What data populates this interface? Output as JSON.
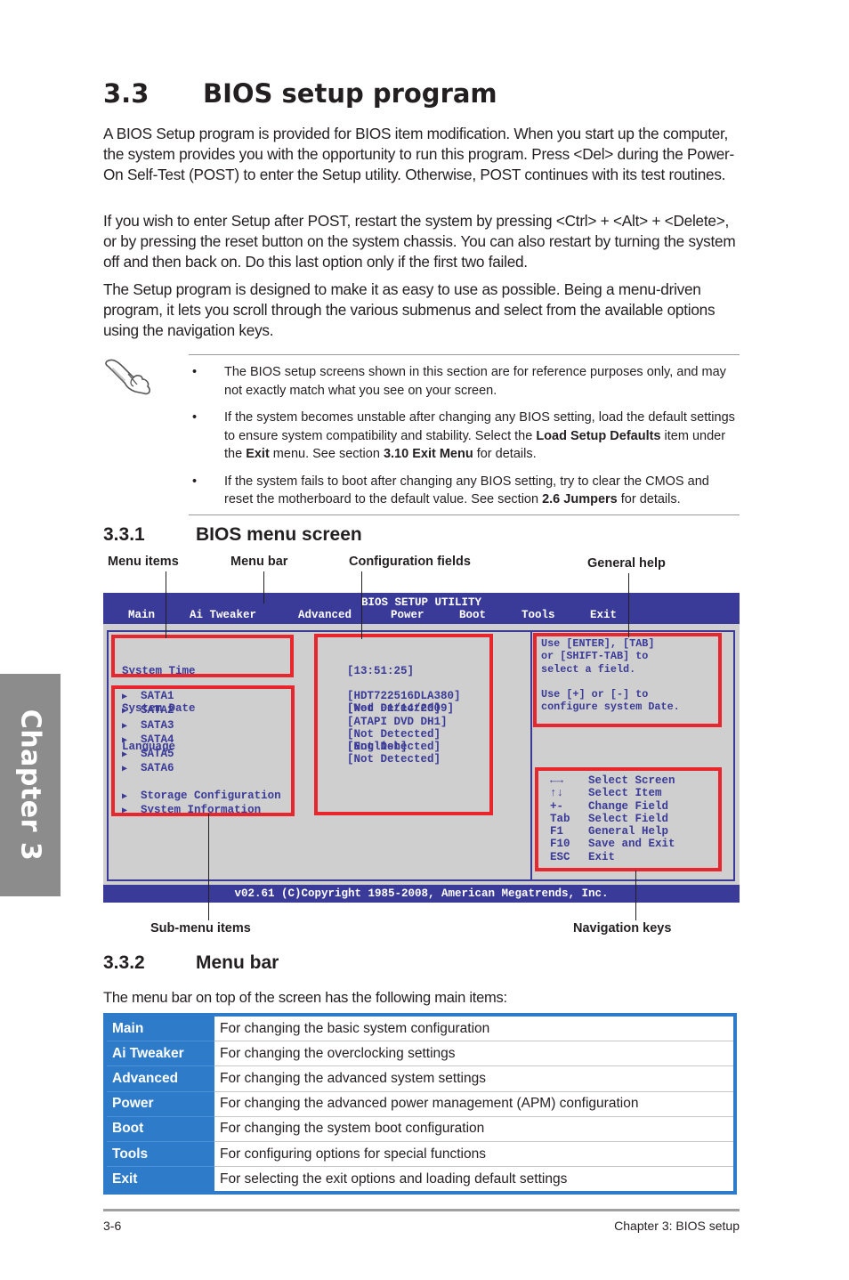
{
  "chapter_tab": "Chapter 3",
  "section": {
    "number": "3.3",
    "title": "BIOS setup program",
    "paragraphs": [
      "A BIOS Setup program is provided for BIOS item modification. When you start up the computer, the system provides you with the opportunity to run this program. Press <Del> during the Power-On Self-Test (POST) to enter the Setup utility. Otherwise, POST continues with its test routines.",
      "If you wish to enter Setup after POST, restart the system by pressing <Ctrl> + <Alt> + <Delete>, or by pressing the reset button on the system chassis. You can also restart by turning the system off and then back on. Do this last option only if the first two failed.",
      "The Setup program is designed to make it as easy to use as possible. Being a menu-driven program, it lets you scroll through the various submenus and select from the available options using the navigation keys."
    ]
  },
  "note": {
    "icon": "hand-pointer-icon",
    "bullet": "•",
    "items": [
      {
        "parts": [
          {
            "t": "The BIOS setup screens shown in this section are for reference purposes only, and may not exactly match what you see on your screen.",
            "b": false
          }
        ]
      },
      {
        "parts": [
          {
            "t": "If the system becomes unstable after changing any BIOS setting, load the default settings to ensure system compatibility and stability. Select the ",
            "b": false
          },
          {
            "t": "Load Setup Defaults",
            "b": true
          },
          {
            "t": " item under the ",
            "b": false
          },
          {
            "t": "Exit",
            "b": true
          },
          {
            "t": " menu. See section ",
            "b": false
          },
          {
            "t": "3.10 Exit Menu",
            "b": true
          },
          {
            "t": " for details.",
            "b": false
          }
        ]
      },
      {
        "parts": [
          {
            "t": "If the system fails to boot after changing any BIOS setting, try to clear the CMOS and reset the motherboard to the default value. See section ",
            "b": false
          },
          {
            "t": "2.6 Jumpers",
            "b": true
          },
          {
            "t": " for details.",
            "b": false
          }
        ]
      }
    ]
  },
  "subsection1": {
    "number": "3.3.1",
    "title": "BIOS menu screen"
  },
  "callouts": {
    "menu_items": "Menu items",
    "menu_bar": "Menu bar",
    "config_fields": "Configuration fields",
    "general_help": "General help",
    "sub_menu_items": "Sub-menu items",
    "navigation_keys": "Navigation keys"
  },
  "bios": {
    "title": "BIOS SETUP UTILITY",
    "menu": [
      "Main",
      "Ai Tweaker",
      "Advanced",
      "Power",
      "Boot",
      "Tools",
      "Exit"
    ],
    "active_menu": "Main",
    "items": [
      "System Time",
      "System Date",
      "Language"
    ],
    "submenu_marker": "▶",
    "sata_items": [
      "SATA1",
      "SATA2",
      "SATA3",
      "SATA4",
      "SATA5",
      "SATA6"
    ],
    "sub_items": [
      "Storage Configuration",
      "System Information"
    ],
    "values": [
      "[13:51:25]",
      "[Wed 01/14/2009]",
      "[English]"
    ],
    "sata_values": [
      "[HDT722516DLA380]",
      "[Not Detected]",
      "[ATAPI DVD DH1]",
      "[Not Detected]",
      "[Not Detected]",
      "[Not Detected]"
    ],
    "help_lines": [
      "Use [ENTER], [TAB]",
      "or [SHIFT-TAB] to",
      "select a field.",
      "",
      "Use [+] or [-] to",
      "configure system Date."
    ],
    "nav_keys": [
      {
        "key": "←→",
        "action": "Select Screen"
      },
      {
        "key": "↑↓",
        "action": "Select Item"
      },
      {
        "key": "+-",
        "action": "Change Field"
      },
      {
        "key": "Tab",
        "action": "Select Field"
      },
      {
        "key": "F1",
        "action": "General Help"
      },
      {
        "key": "F10",
        "action": "Save and Exit"
      },
      {
        "key": "ESC",
        "action": "Exit"
      }
    ],
    "copyright": "v02.61 (C)Copyright 1985-2008, American Megatrends, Inc.",
    "colors": {
      "bar": "#3a3a98",
      "background": "#cfcfcf",
      "highlight": "#e8262d"
    }
  },
  "subsection2": {
    "number": "3.3.2",
    "title": "Menu bar",
    "intro": "The menu bar on top of the screen has the following main items:"
  },
  "menu_table": {
    "accent": "#2e7cc9",
    "rows": [
      {
        "key": "Main",
        "desc": "For changing the basic system configuration"
      },
      {
        "key": "Ai Tweaker",
        "desc": "For changing the overclocking settings"
      },
      {
        "key": "Advanced",
        "desc": "For changing the advanced system settings"
      },
      {
        "key": "Power",
        "desc": "For changing the advanced power management (APM) configuration"
      },
      {
        "key": "Boot",
        "desc": "For changing the system boot configuration"
      },
      {
        "key": "Tools",
        "desc": "For configuring options for special functions"
      },
      {
        "key": "Exit",
        "desc": "For selecting the exit options and loading default settings"
      }
    ]
  },
  "footer": {
    "page": "3-6",
    "chapter": "Chapter 3: BIOS setup"
  }
}
